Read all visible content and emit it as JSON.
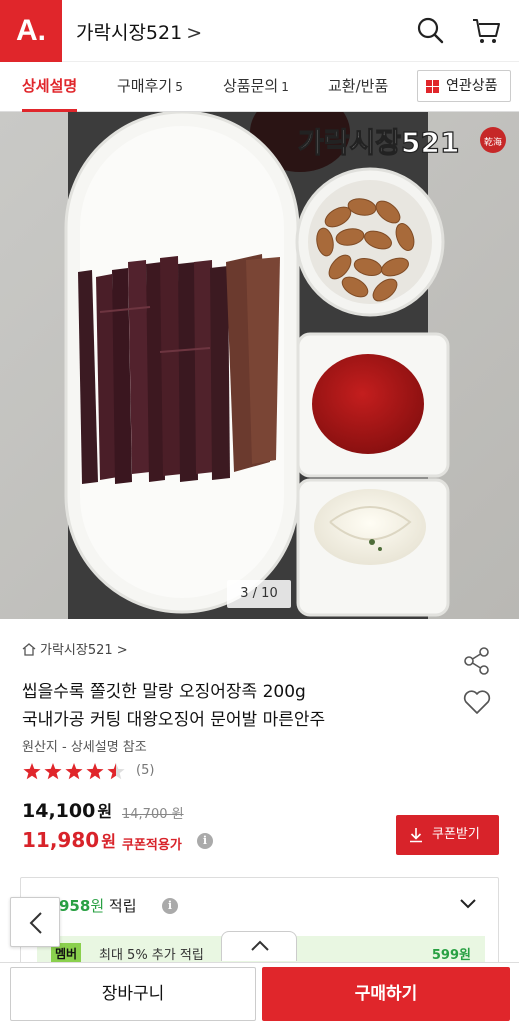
{
  "header": {
    "logo_text": "A.",
    "store_name": "가락시장521",
    "chevron": ">",
    "icons": [
      "search-icon",
      "cart-icon"
    ]
  },
  "tabs": [
    {
      "label": "상세설명",
      "count": "",
      "active": true
    },
    {
      "label": "구매후기",
      "count": "5",
      "active": false
    },
    {
      "label": "상품문의",
      "count": "1",
      "active": false
    },
    {
      "label": "교환/반품",
      "count": "",
      "active": false
    }
  ],
  "related_tab": {
    "label": "연관상품",
    "icon": "grid-icon"
  },
  "image": {
    "counter": "3 / 10",
    "overlay_brand": "가락시장521",
    "overlay_seal": "乾海"
  },
  "product": {
    "breadcrumb": "가락시장521",
    "breadcrumb_chevron": ">",
    "title_line1": "씹을수록 쫄깃한 말랑 오징어장족 200g",
    "title_line2": "국내가공 커팅 대왕오징어 문어발 마른안주",
    "origin": "원산지 - 상세설명 참조",
    "rating": 4.5,
    "review_count": "(5)",
    "price": "14,100",
    "price_unit": "원",
    "original_price": "14,700 원",
    "sale_price": "11,980",
    "sale_unit": "원",
    "coupon_applied": "쿠폰적용가",
    "coupon_button": "쿠폰받기"
  },
  "points": {
    "amount": "958",
    "unit": "원",
    "label": "적립",
    "member_badge": "멤버",
    "member_text": "최대 5% 추가 적립",
    "member_points": "599원"
  },
  "bottom_bar": {
    "cart_label": "장바구니",
    "buy_label": "구매하기"
  },
  "colors": {
    "brand": "#e0262b",
    "sale": "#d8232a",
    "points": "#29a043"
  }
}
